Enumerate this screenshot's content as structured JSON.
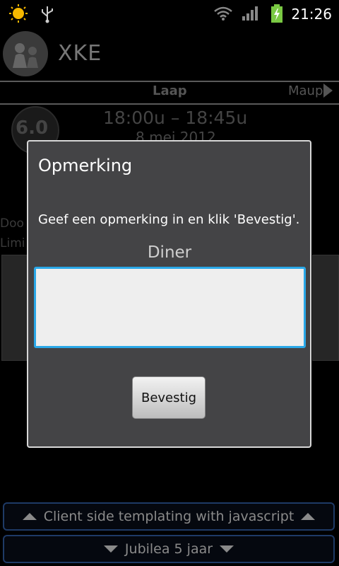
{
  "status_bar": {
    "time": "21:26",
    "icons": [
      "sun-icon",
      "usb-icon",
      "wifi-icon",
      "signal-icon",
      "battery-charging-icon"
    ]
  },
  "app": {
    "title": "XKE"
  },
  "tabs": {
    "current": "Laap",
    "next": "Maup"
  },
  "session": {
    "score": "6.0",
    "time_range": "18:00u – 18:45u",
    "date": "8 mei 2012"
  },
  "background": {
    "text1": "Doo",
    "text2": "Limi"
  },
  "dialog": {
    "title": "Opmerking",
    "message": "Geef een opmerking in en klik 'Bevestig'.",
    "label": "Diner",
    "input_value": "",
    "confirm_label": "Bevestig"
  },
  "bottom_bars": {
    "prev_label": "Client side templating with javascript",
    "next_label": "Jubilea 5 jaar"
  },
  "colors": {
    "accent": "#2aa8e8",
    "dialog_bg": "#444446",
    "battery": "#7ac943"
  }
}
